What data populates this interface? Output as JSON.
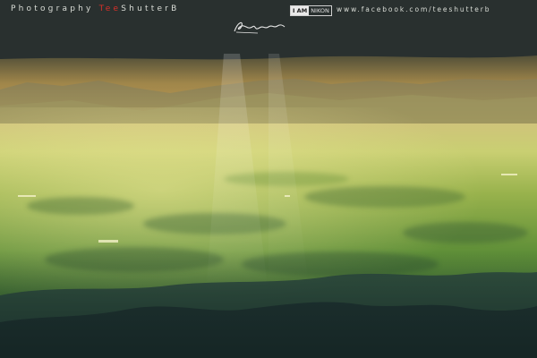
{
  "photo": {
    "subject": "mountain-valley-landscape-with-light-rays",
    "colors": {
      "storm_cloud": "#2b3433",
      "sky_glow": "#c8a55a",
      "distant_mountains": "#8d8a63",
      "plain_green": "#6f9a3a",
      "bright_haze": "#d9d880",
      "foreground_ridges": "#243a38"
    }
  },
  "watermark": {
    "brand_prefix": "Photography",
    "brand_accent": "Tee",
    "brand_suffix": "ShutterB",
    "badge_a": "I AM",
    "badge_b": "NIKON",
    "url": "www.facebook.com/teeshutterb"
  }
}
